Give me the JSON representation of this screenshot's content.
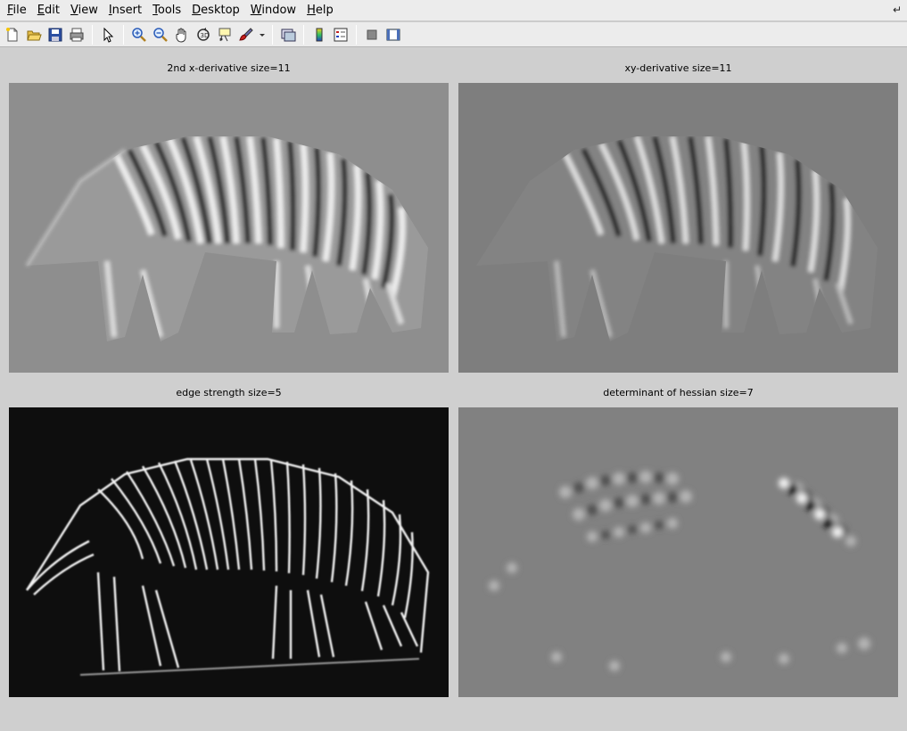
{
  "menubar": {
    "items": [
      {
        "label": "File",
        "u": "F",
        "rest": "ile"
      },
      {
        "label": "Edit",
        "u": "E",
        "rest": "dit"
      },
      {
        "label": "View",
        "u": "V",
        "rest": "iew"
      },
      {
        "label": "Insert",
        "u": "I",
        "rest": "nsert"
      },
      {
        "label": "Tools",
        "u": "T",
        "rest": "ools"
      },
      {
        "label": "Desktop",
        "u": "D",
        "rest": "esktop"
      },
      {
        "label": "Window",
        "u": "W",
        "rest": "indow"
      },
      {
        "label": "Help",
        "u": "H",
        "rest": "elp"
      }
    ]
  },
  "toolbar": {
    "icons": [
      "new-figure-icon",
      "open-file-icon",
      "save-icon",
      "print-icon",
      "edit-plot-pointer-icon",
      "zoom-in-icon",
      "zoom-out-icon",
      "pan-hand-icon",
      "rotate-3d-icon",
      "data-cursor-icon",
      "brush-icon",
      "brush-dropdown-icon",
      "link-plot-icon",
      "colorbar-icon",
      "legend-icon",
      "hide-plot-tools-icon",
      "show-plot-tools-icon"
    ]
  },
  "axes": [
    {
      "title": "2nd x-derivative size=11",
      "style": "gray-emboss"
    },
    {
      "title": "xy-derivative size=11",
      "style": "gray-emboss-dark"
    },
    {
      "title": "edge strength size=5",
      "style": "edge-dark"
    },
    {
      "title": "determinant of hessian size=7",
      "style": "flat-gray"
    }
  ],
  "colors": {
    "figure_bg": "#cfcfcf",
    "panel_gray": "#8a8a8a",
    "panel_gray2": "#7a7a7a",
    "edge_bg": "#0d0d0d",
    "hessian_bg": "#808080"
  }
}
